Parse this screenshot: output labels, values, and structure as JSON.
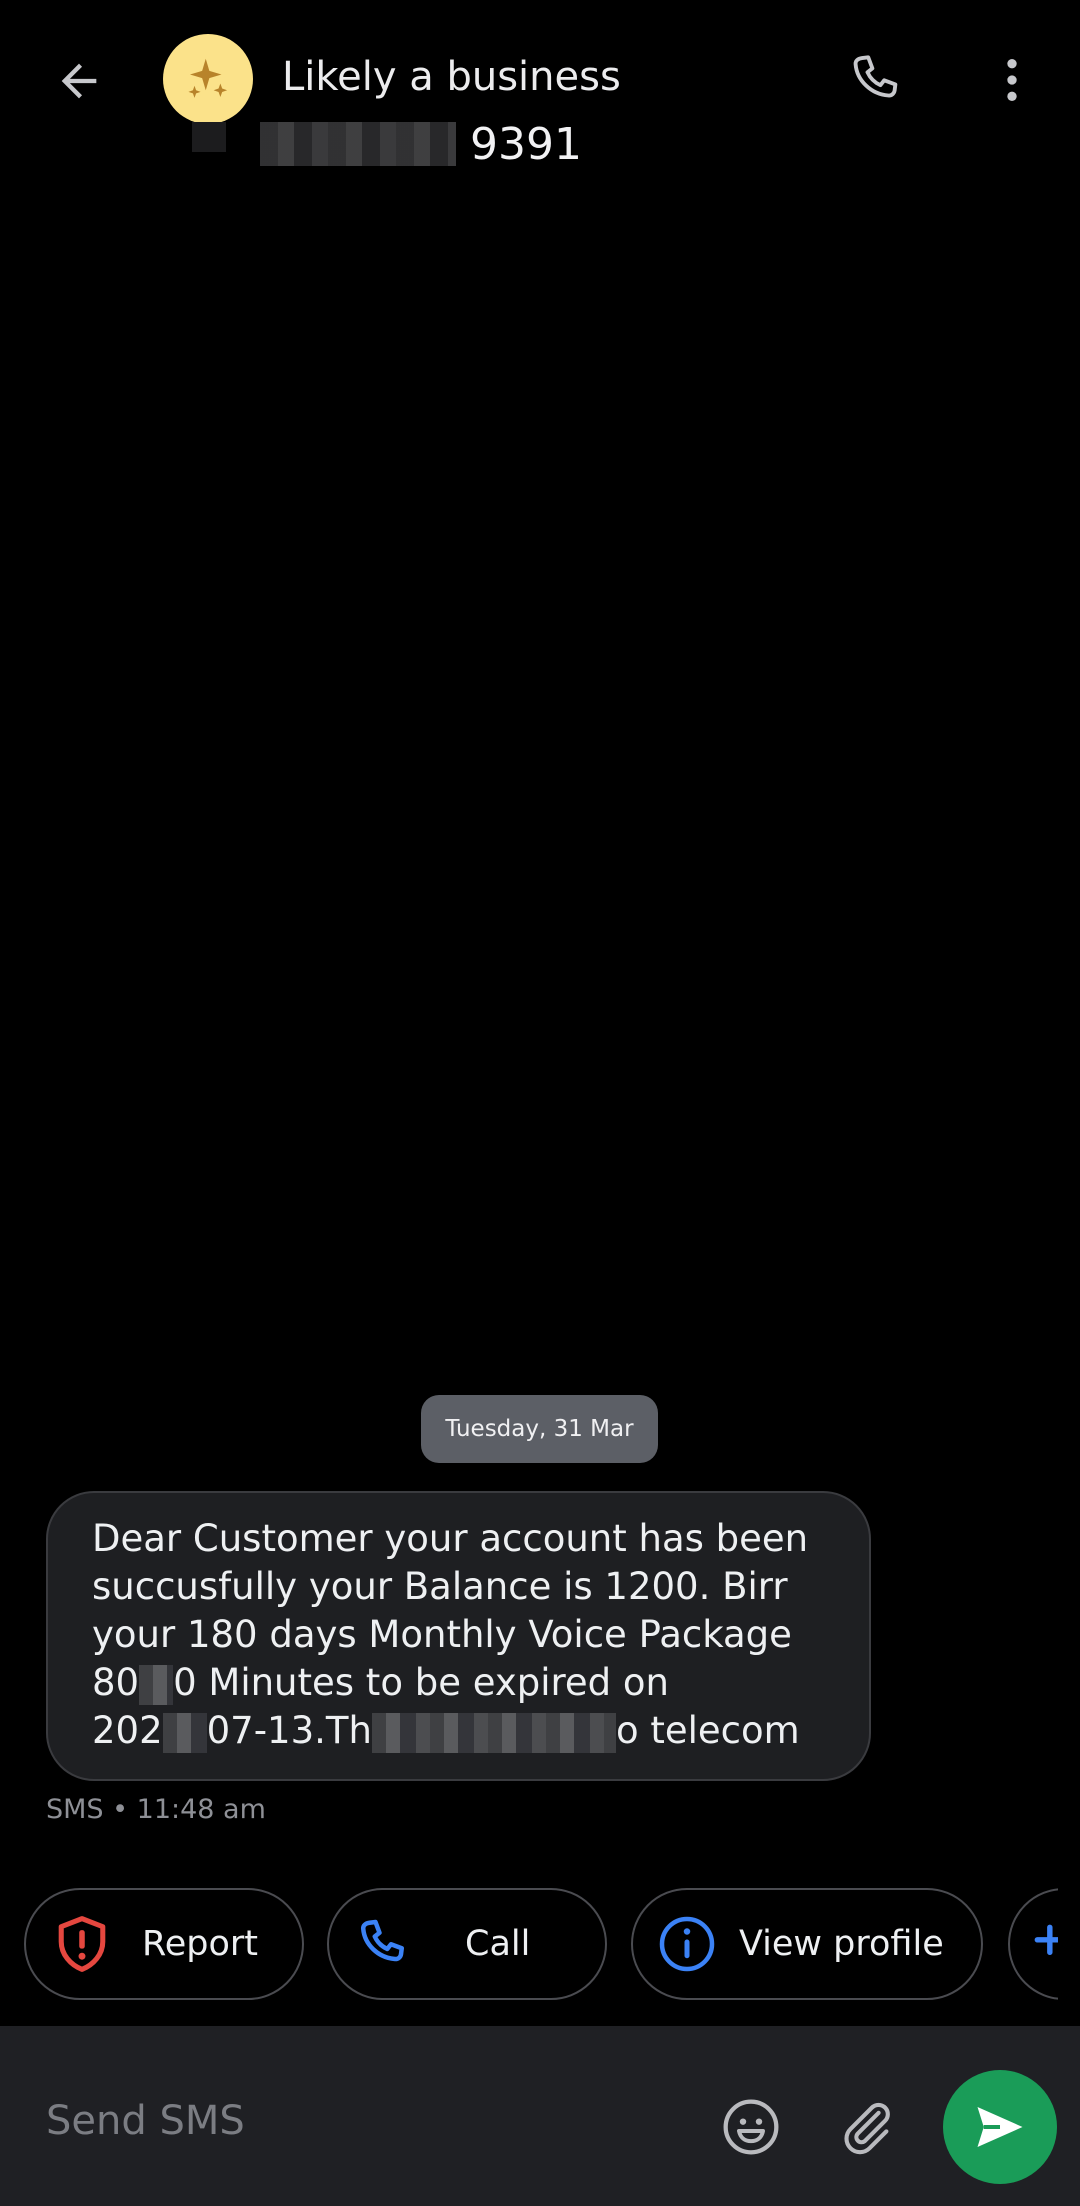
{
  "header": {
    "title": "Likely a business",
    "number_suffix": "9391",
    "avatar_icon": "sparkle-icon",
    "accent_avatar": "#fbe28a"
  },
  "conversation": {
    "date": "Tuesday, 31 Mar",
    "message": {
      "line1": " Dear Customer your  account has been",
      "line2": "succusfully your Balance is 1200. Birr",
      "line3": "your 180 days  Monthly Voice Package",
      "line4_a": "80",
      "line4_b": "0 Minutes   to be expired on",
      "line5_a": "202",
      "line5_b": "07-13.Th",
      "line5_c": "o telecom"
    },
    "meta": "SMS • 11:48 am"
  },
  "actions": [
    {
      "label": "Report",
      "icon": "shield-alert-icon",
      "color": "#e5473f"
    },
    {
      "label": "Call",
      "icon": "phone-icon",
      "color": "#3b82f6"
    },
    {
      "label": "View profile",
      "icon": "info-icon",
      "color": "#3b82f6"
    },
    {
      "label": "",
      "icon": "add-contact-icon",
      "color": "#3b82f6"
    }
  ],
  "compose": {
    "placeholder": "Send SMS",
    "send_color": "#1a9c58"
  }
}
